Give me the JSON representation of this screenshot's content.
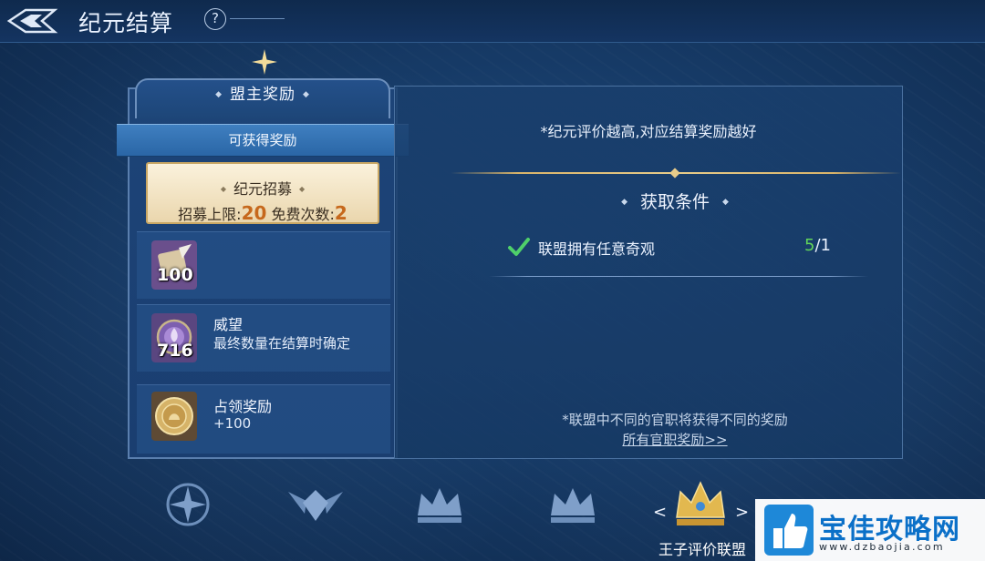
{
  "header": {
    "title": "纪元结算",
    "help_icon": "question-icon"
  },
  "left_panel": {
    "heading": "盟主奖励",
    "ribbon_label": "可获得奖励",
    "recruit": {
      "title": "纪元招募",
      "limit_label": "招募上限:",
      "limit_value": "20",
      "free_label": "免费次数:",
      "free_value": "2"
    },
    "rewards": [
      {
        "icon": "scroll-quill-icon",
        "count": "100",
        "title": "",
        "subtitle": ""
      },
      {
        "icon": "prestige-lotus-icon",
        "count": "716",
        "title": "威望",
        "subtitle": "最终数量在结算时确定"
      },
      {
        "icon": "gold-coin-icon",
        "count": "",
        "title": "占领奖励",
        "subtitle": "+100"
      }
    ]
  },
  "right_panel": {
    "hint_top": "*纪元评价越高,对应结算奖励越好",
    "conditions_heading": "获取条件",
    "condition": {
      "text": "联盟拥有任意奇观",
      "progress_current": "5",
      "progress_total": "/1"
    },
    "hint_bottom": "*联盟中不同的官职将获得不同的奖励",
    "link_label": "所有官职奖励>>"
  },
  "tabs": {
    "active_label": "王子评价联盟",
    "arrow_left": "<",
    "arrow_right": ">"
  },
  "watermark": {
    "text": "宝佳攻略网",
    "url": "www.dzbaojia.com"
  },
  "colors": {
    "accent_gold": "#e8cc8a",
    "progress_green": "#62d65a",
    "number_orange": "#c6681c"
  }
}
